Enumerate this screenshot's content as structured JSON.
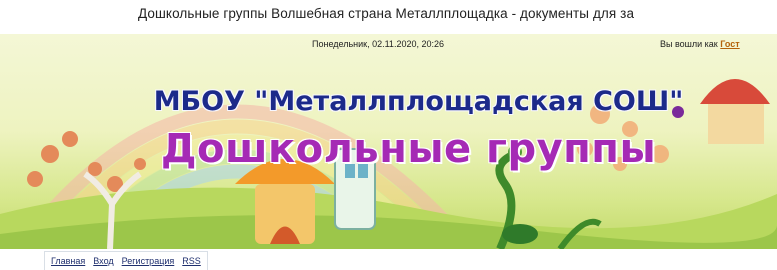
{
  "page": {
    "title": "Дошкольные группы Волшебная страна Металлплощадка - документы для за"
  },
  "header": {
    "date": "Понедельник, 02.11.2020, 20:26",
    "login_prefix": "Вы вошли как",
    "login_user": "Гост",
    "school_name": "МБОУ \"Металлплощадская СОШ\"",
    "subtitle": "Дошкольные группы"
  },
  "nav": {
    "items": [
      "Главная",
      "Вход",
      "Регистрация",
      "RSS"
    ]
  },
  "colors": {
    "school_name": "#1c2a8a",
    "subtitle": "#a52ab5",
    "guest_link": "#b4620a"
  }
}
